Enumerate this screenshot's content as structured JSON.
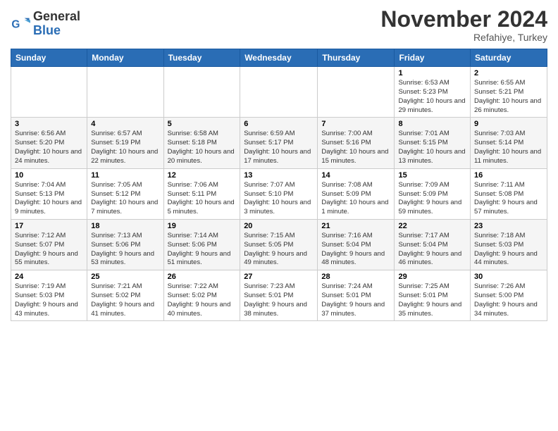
{
  "logo": {
    "general": "General",
    "blue": "Blue"
  },
  "header": {
    "month": "November 2024",
    "location": "Refahiye, Turkey"
  },
  "weekdays": [
    "Sunday",
    "Monday",
    "Tuesday",
    "Wednesday",
    "Thursday",
    "Friday",
    "Saturday"
  ],
  "weeks": [
    [
      {
        "day": "",
        "info": ""
      },
      {
        "day": "",
        "info": ""
      },
      {
        "day": "",
        "info": ""
      },
      {
        "day": "",
        "info": ""
      },
      {
        "day": "",
        "info": ""
      },
      {
        "day": "1",
        "info": "Sunrise: 6:53 AM\nSunset: 5:23 PM\nDaylight: 10 hours and 29 minutes."
      },
      {
        "day": "2",
        "info": "Sunrise: 6:55 AM\nSunset: 5:21 PM\nDaylight: 10 hours and 26 minutes."
      }
    ],
    [
      {
        "day": "3",
        "info": "Sunrise: 6:56 AM\nSunset: 5:20 PM\nDaylight: 10 hours and 24 minutes."
      },
      {
        "day": "4",
        "info": "Sunrise: 6:57 AM\nSunset: 5:19 PM\nDaylight: 10 hours and 22 minutes."
      },
      {
        "day": "5",
        "info": "Sunrise: 6:58 AM\nSunset: 5:18 PM\nDaylight: 10 hours and 20 minutes."
      },
      {
        "day": "6",
        "info": "Sunrise: 6:59 AM\nSunset: 5:17 PM\nDaylight: 10 hours and 17 minutes."
      },
      {
        "day": "7",
        "info": "Sunrise: 7:00 AM\nSunset: 5:16 PM\nDaylight: 10 hours and 15 minutes."
      },
      {
        "day": "8",
        "info": "Sunrise: 7:01 AM\nSunset: 5:15 PM\nDaylight: 10 hours and 13 minutes."
      },
      {
        "day": "9",
        "info": "Sunrise: 7:03 AM\nSunset: 5:14 PM\nDaylight: 10 hours and 11 minutes."
      }
    ],
    [
      {
        "day": "10",
        "info": "Sunrise: 7:04 AM\nSunset: 5:13 PM\nDaylight: 10 hours and 9 minutes."
      },
      {
        "day": "11",
        "info": "Sunrise: 7:05 AM\nSunset: 5:12 PM\nDaylight: 10 hours and 7 minutes."
      },
      {
        "day": "12",
        "info": "Sunrise: 7:06 AM\nSunset: 5:11 PM\nDaylight: 10 hours and 5 minutes."
      },
      {
        "day": "13",
        "info": "Sunrise: 7:07 AM\nSunset: 5:10 PM\nDaylight: 10 hours and 3 minutes."
      },
      {
        "day": "14",
        "info": "Sunrise: 7:08 AM\nSunset: 5:09 PM\nDaylight: 10 hours and 1 minute."
      },
      {
        "day": "15",
        "info": "Sunrise: 7:09 AM\nSunset: 5:09 PM\nDaylight: 9 hours and 59 minutes."
      },
      {
        "day": "16",
        "info": "Sunrise: 7:11 AM\nSunset: 5:08 PM\nDaylight: 9 hours and 57 minutes."
      }
    ],
    [
      {
        "day": "17",
        "info": "Sunrise: 7:12 AM\nSunset: 5:07 PM\nDaylight: 9 hours and 55 minutes."
      },
      {
        "day": "18",
        "info": "Sunrise: 7:13 AM\nSunset: 5:06 PM\nDaylight: 9 hours and 53 minutes."
      },
      {
        "day": "19",
        "info": "Sunrise: 7:14 AM\nSunset: 5:06 PM\nDaylight: 9 hours and 51 minutes."
      },
      {
        "day": "20",
        "info": "Sunrise: 7:15 AM\nSunset: 5:05 PM\nDaylight: 9 hours and 49 minutes."
      },
      {
        "day": "21",
        "info": "Sunrise: 7:16 AM\nSunset: 5:04 PM\nDaylight: 9 hours and 48 minutes."
      },
      {
        "day": "22",
        "info": "Sunrise: 7:17 AM\nSunset: 5:04 PM\nDaylight: 9 hours and 46 minutes."
      },
      {
        "day": "23",
        "info": "Sunrise: 7:18 AM\nSunset: 5:03 PM\nDaylight: 9 hours and 44 minutes."
      }
    ],
    [
      {
        "day": "24",
        "info": "Sunrise: 7:19 AM\nSunset: 5:03 PM\nDaylight: 9 hours and 43 minutes."
      },
      {
        "day": "25",
        "info": "Sunrise: 7:21 AM\nSunset: 5:02 PM\nDaylight: 9 hours and 41 minutes."
      },
      {
        "day": "26",
        "info": "Sunrise: 7:22 AM\nSunset: 5:02 PM\nDaylight: 9 hours and 40 minutes."
      },
      {
        "day": "27",
        "info": "Sunrise: 7:23 AM\nSunset: 5:01 PM\nDaylight: 9 hours and 38 minutes."
      },
      {
        "day": "28",
        "info": "Sunrise: 7:24 AM\nSunset: 5:01 PM\nDaylight: 9 hours and 37 minutes."
      },
      {
        "day": "29",
        "info": "Sunrise: 7:25 AM\nSunset: 5:01 PM\nDaylight: 9 hours and 35 minutes."
      },
      {
        "day": "30",
        "info": "Sunrise: 7:26 AM\nSunset: 5:00 PM\nDaylight: 9 hours and 34 minutes."
      }
    ]
  ]
}
